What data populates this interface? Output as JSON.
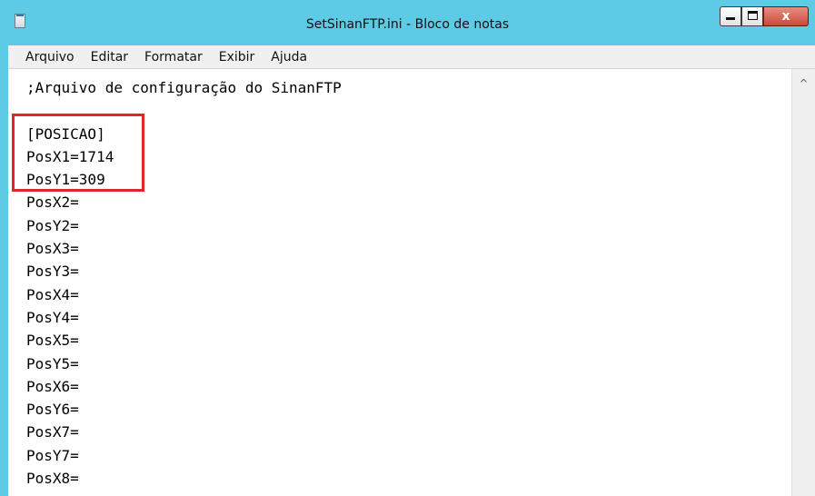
{
  "window": {
    "title": "SetSinanFTP.ini - Bloco de notas",
    "controls": {
      "minimize": "—",
      "maximize": "□",
      "close": "x"
    }
  },
  "menu": {
    "items": [
      "Arquivo",
      "Editar",
      "Formatar",
      "Exibir",
      "Ajuda"
    ]
  },
  "editor": {
    "lines": [
      ";Arquivo de configuração do SinanFTP",
      "",
      "[POSICAO]",
      "PosX1=1714",
      "PosY1=309",
      "PosX2=",
      "PosY2=",
      "PosX3=",
      "PosY3=",
      "PosX4=",
      "PosY4=",
      "PosX5=",
      "PosY5=",
      "PosX6=",
      "PosY6=",
      "PosX7=",
      "PosY7=",
      "PosX8="
    ]
  },
  "scrollbar": {
    "up_arrow": "^"
  },
  "colors": {
    "titlebar": "#5ecbe6",
    "highlight": "#e0262b",
    "close_button": "#c64a39"
  },
  "icons": {
    "app": "notepad-icon",
    "minimize": "minimize-icon",
    "maximize": "maximize-icon",
    "close": "close-icon",
    "scroll_up": "chevron-up-icon"
  }
}
